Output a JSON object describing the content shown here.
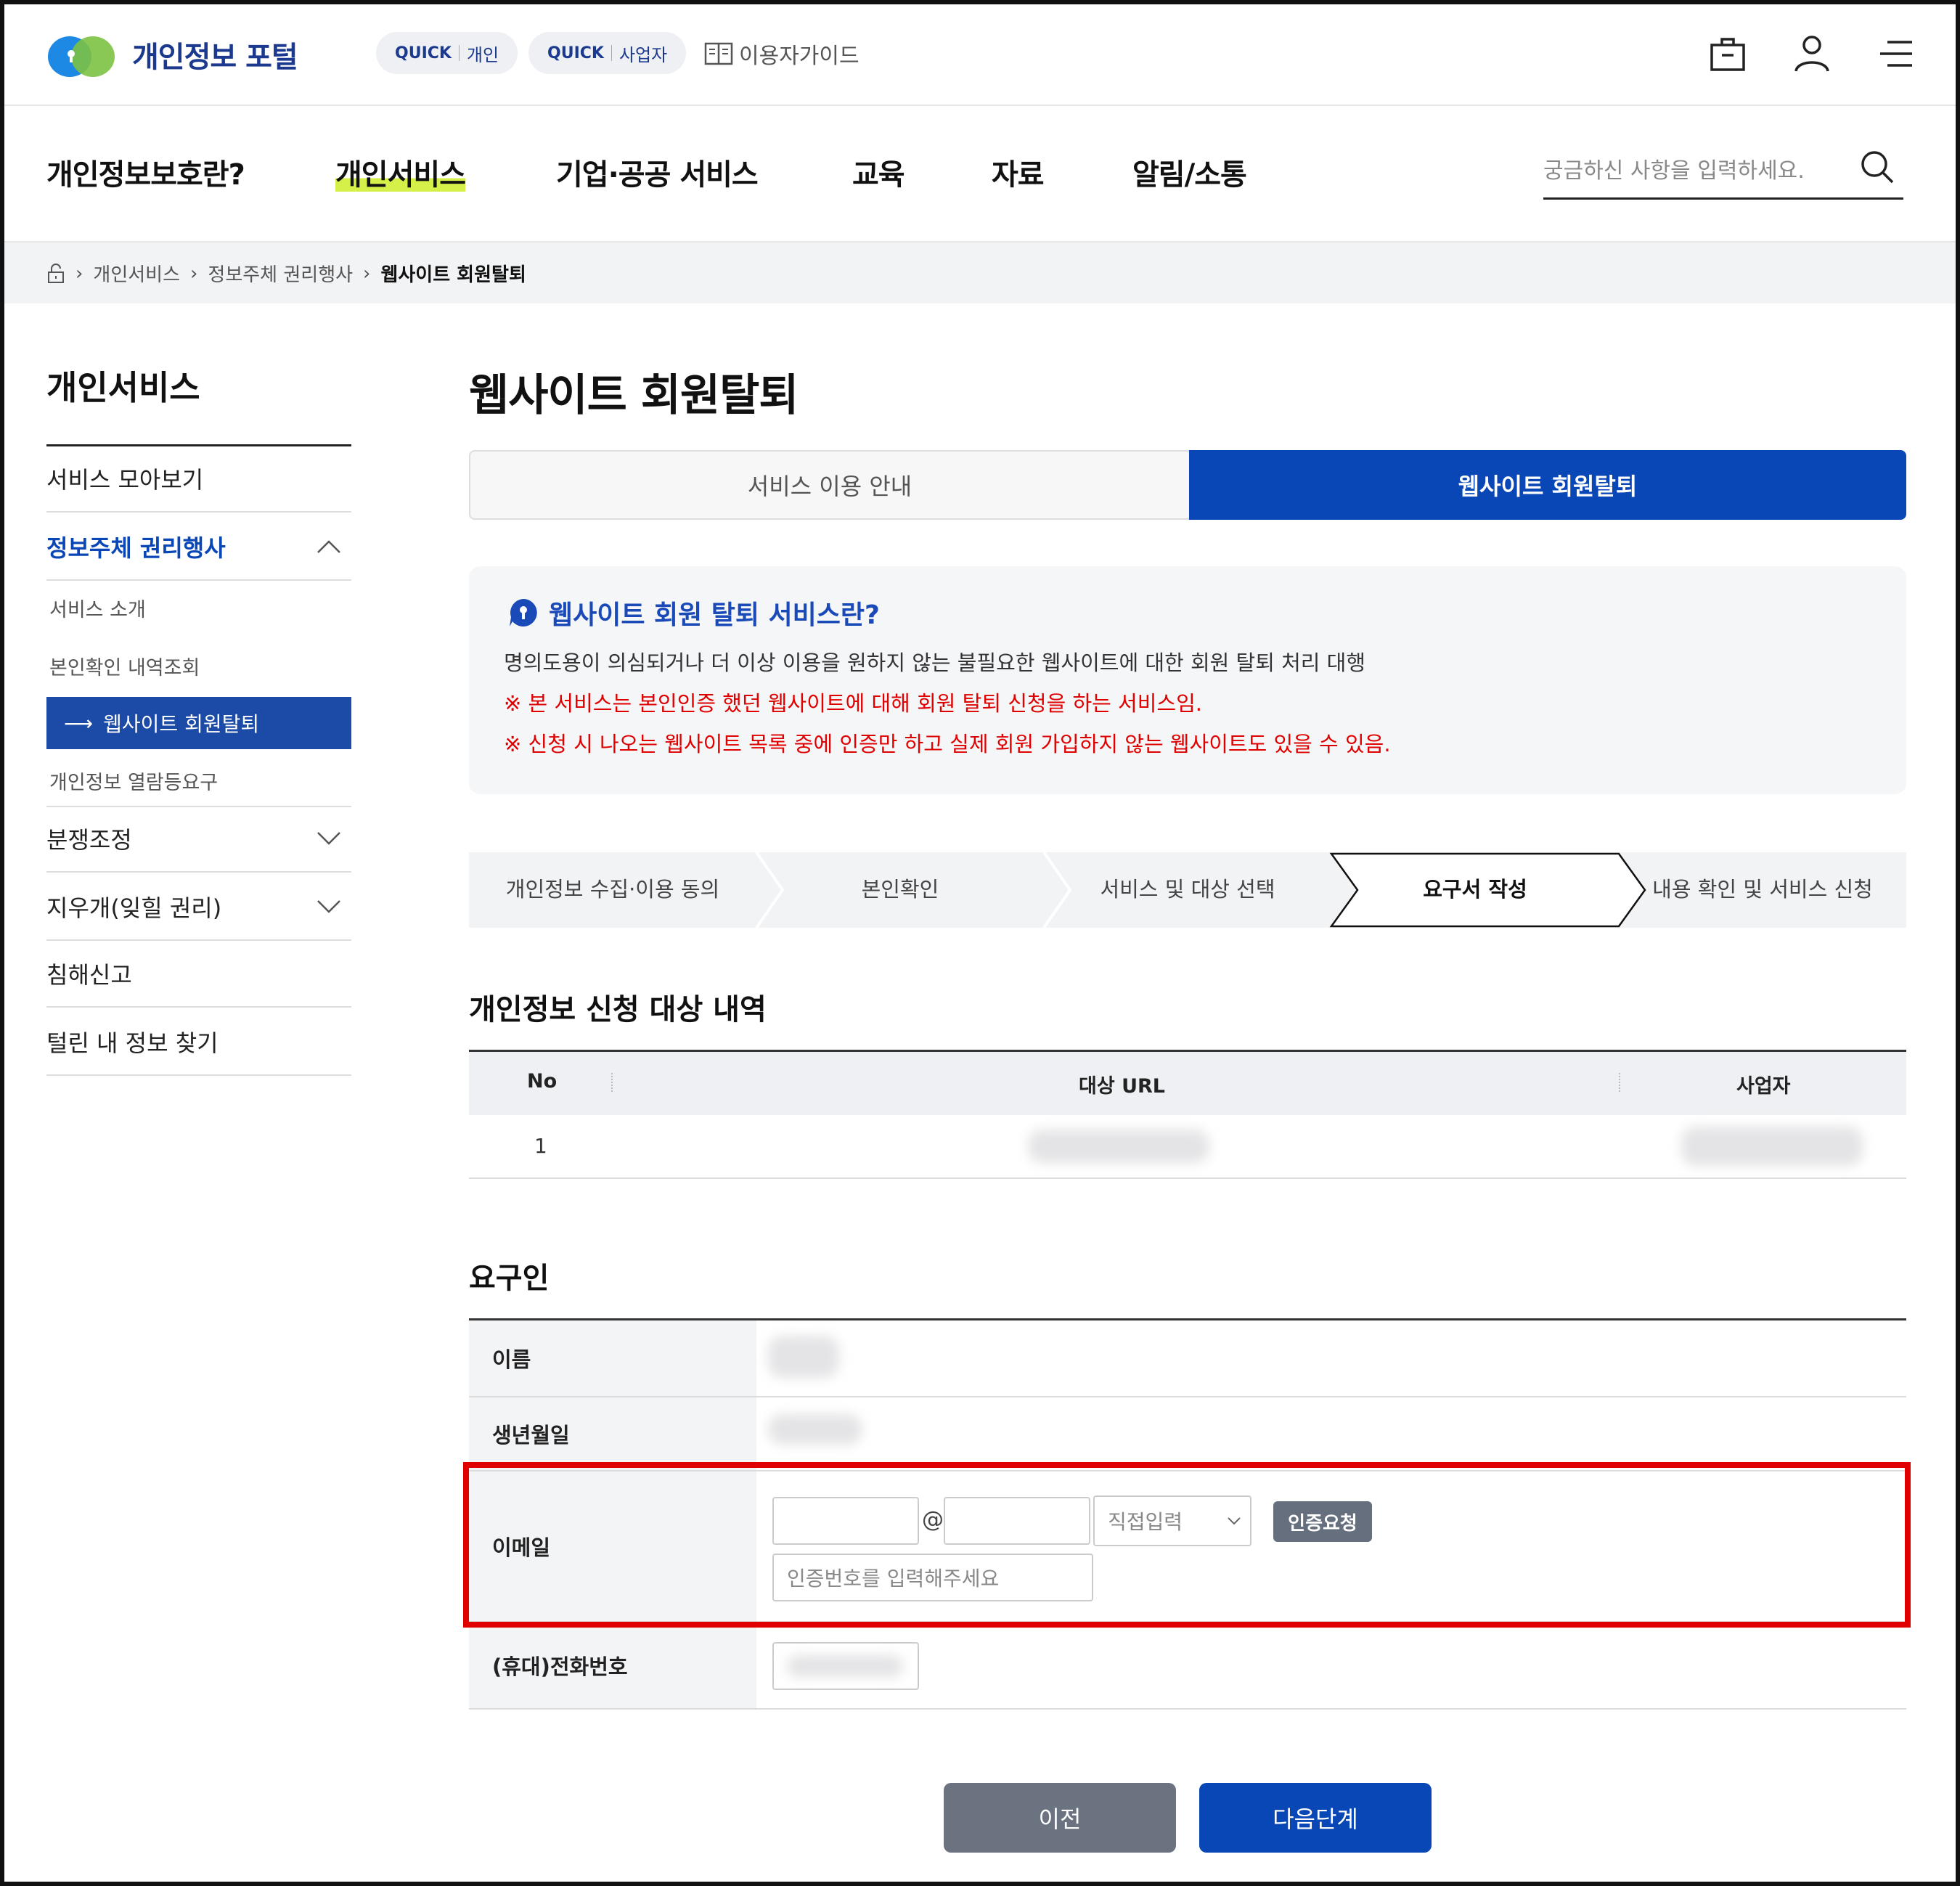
{
  "header": {
    "logo_text": "개인정보 포털",
    "quick_personal": {
      "q": "QUICK",
      "label": "개인"
    },
    "quick_business": {
      "q": "QUICK",
      "label": "사업자"
    },
    "user_guide": "이용자가이드"
  },
  "gnb": {
    "items": [
      "개인정보보호란?",
      "개인서비스",
      "기업·공공 서비스",
      "교육",
      "자료",
      "알림/소통"
    ],
    "search_placeholder": "궁금하신 사항을 입력하세요."
  },
  "breadcrumb": [
    "개인서비스",
    "정보주체 권리행사",
    "웹사이트 회원탈퇴"
  ],
  "lnb": {
    "title": "개인서비스",
    "items": [
      "서비스 모아보기",
      "정보주체 권리행사",
      "개인정보 열람등요구",
      "분쟁조정",
      "지우개(잊힐 권리)",
      "침해신고",
      "털린 내 정보 찾기"
    ],
    "subitems": [
      "서비스 소개",
      "본인확인 내역조회",
      "웹사이트 회원탈퇴"
    ]
  },
  "page_title": "웹사이트 회원탈퇴",
  "tabs": [
    "서비스 이용 안내",
    "웹사이트 회원탈퇴"
  ],
  "info": {
    "title": "웹사이트 회원 탈퇴 서비스란?",
    "desc": "명의도용이 의심되거나 더 이상 이용을 원하지 않는 불필요한 웹사이트에 대한 회원 탈퇴 처리 대행",
    "note1": "※ 본 서비스는 본인인증 했던 웹사이트에 대해 회원 탈퇴 신청을 하는 서비스임.",
    "note2": "※ 신청 시 나오는 웹사이트 목록 중에 인증만 하고 실제 회원 가입하지 않는 웹사이트도 있을 수 있음."
  },
  "steps": [
    "개인정보 수집·이용 동의",
    "본인확인",
    "서비스 및 대상 선택",
    "요구서 작성",
    "내용 확인 및 서비스 신청"
  ],
  "target_section": {
    "title": "개인정보 신청 대상 내역",
    "columns": [
      "No",
      "대상 URL",
      "사업자"
    ],
    "rows": [
      {
        "no": "1"
      }
    ]
  },
  "requester": {
    "title": "요구인",
    "labels": [
      "이름",
      "생년월일",
      "이메일",
      "(휴대)전화번호"
    ],
    "email_at": "@",
    "email_domain_select": "직접입력",
    "cert_button": "인증요청",
    "cert_placeholder": "인증번호를 입력해주세요"
  },
  "buttons": {
    "prev": "이전",
    "next": "다음단계"
  },
  "colors": {
    "primary": "#0a47b6",
    "highlight": "#e00000",
    "note": "#e00000"
  }
}
